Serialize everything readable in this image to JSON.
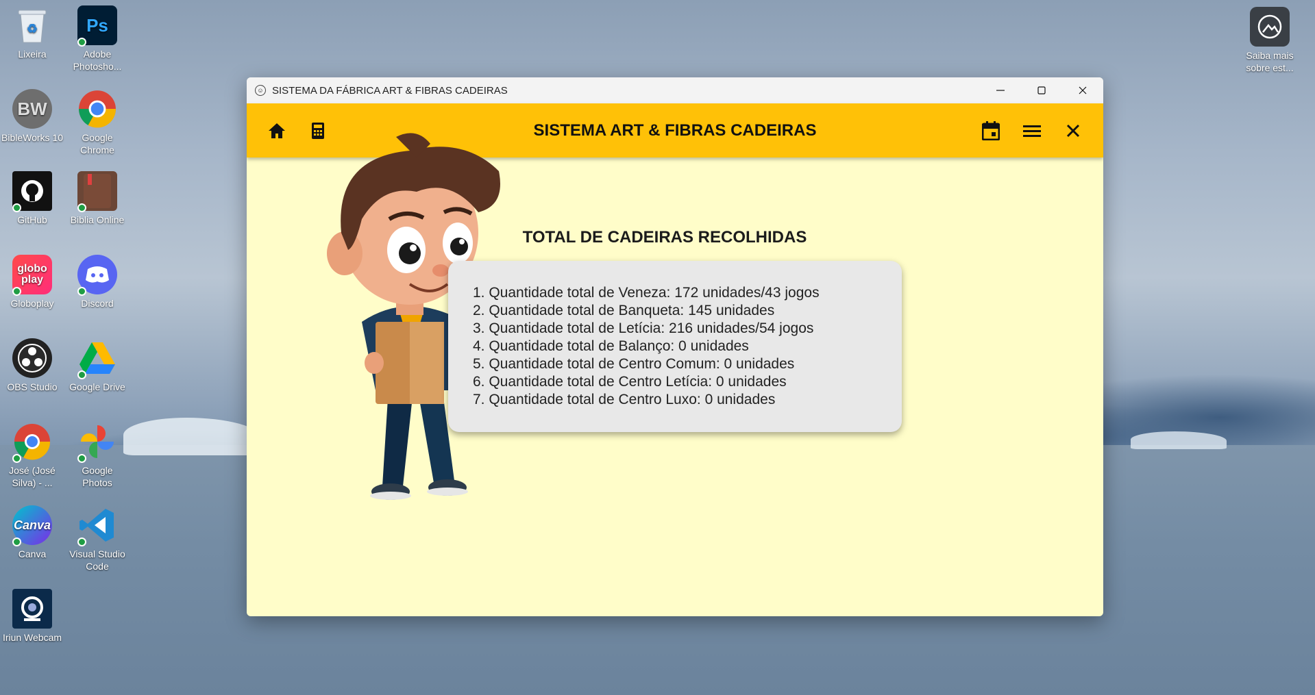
{
  "desktop": {
    "icons": [
      {
        "label": "Lixeira",
        "icon": "recycle-bin-icon"
      },
      {
        "label": "Adobe Photosho...",
        "icon": "photoshop-icon",
        "glyph": "Ps"
      },
      {
        "label": "BibleWorks 10",
        "icon": "bibleworks-icon",
        "glyph": "BW"
      },
      {
        "label": "Google Chrome",
        "icon": "chrome-icon"
      },
      {
        "label": "GitHub",
        "icon": "github-icon"
      },
      {
        "label": "Biblia Online",
        "icon": "bible-icon"
      },
      {
        "label": "Globoplay",
        "icon": "globoplay-icon",
        "glyph": "globo play"
      },
      {
        "label": "Discord",
        "icon": "discord-icon"
      },
      {
        "label": "OBS Studio",
        "icon": "obs-icon"
      },
      {
        "label": "Google Drive",
        "icon": "google-drive-icon"
      },
      {
        "label": "José (José Silva) - ...",
        "icon": "chrome-profile-icon"
      },
      {
        "label": "Google Photos",
        "icon": "google-photos-icon"
      },
      {
        "label": "Canva",
        "icon": "canva-icon",
        "glyph": "Canva"
      },
      {
        "label": "Visual Studio Code",
        "icon": "vscode-icon"
      },
      {
        "label": "Iriun Webcam",
        "icon": "webcam-icon"
      },
      {
        "label": "Saiba mais sobre est...",
        "icon": "learn-more-icon"
      }
    ]
  },
  "window": {
    "title": "SISTEMA DA FÁBRICA ART & FIBRAS CADEIRAS",
    "controls": [
      "minimize-icon",
      "maximize-icon",
      "close-icon"
    ]
  },
  "appbar": {
    "title": "SISTEMA ART & FIBRAS CADEIRAS",
    "left_icons": [
      "home-icon",
      "calculator-icon"
    ],
    "right_icons": [
      "calendar-icon",
      "menu-icon",
      "close-icon"
    ],
    "color": "#ffc107"
  },
  "main": {
    "background": "#fffdc9",
    "section_title": "TOTAL DE CADEIRAS RECOLHIDAS",
    "items": [
      "1. Quantidade total de Veneza: 172 unidades/43 jogos",
      "2. Quantidade total de Banqueta: 145 unidades",
      "3. Quantidade total de Letícia: 216 unidades/54 jogos",
      "4. Quantidade total de Balanço: 0 unidades",
      "5. Quantidade total de Centro Comum: 0 unidades",
      "6. Quantidade total de Centro Letícia: 0 unidades",
      "7. Quantidade total de Centro Luxo: 0 unidades"
    ]
  }
}
